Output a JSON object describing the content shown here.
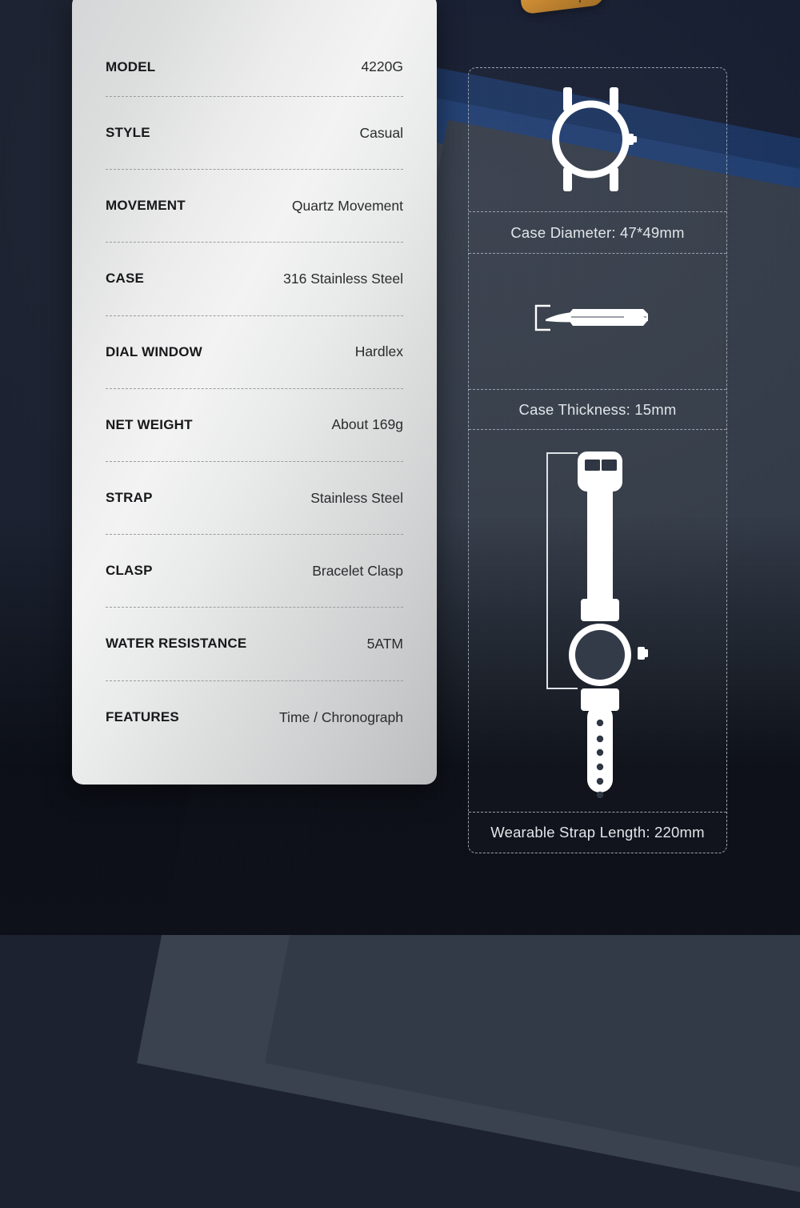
{
  "background": {
    "base_color": "#1b2130",
    "band_navy": "#141b2e",
    "band_blue": "#17305c",
    "band_steel": "#3b424f",
    "gold_accent": "#c7862c"
  },
  "specs_card": {
    "surface_color": "#ececec",
    "label_color": "#17181a",
    "value_color": "#2a2b2d",
    "rows": [
      {
        "label": "MODEL",
        "value": "4220G"
      },
      {
        "label": "STYLE",
        "value": "Casual"
      },
      {
        "label": "MOVEMENT",
        "value": "Quartz Movement"
      },
      {
        "label": "CASE",
        "value": "316 Stainless Steel"
      },
      {
        "label": "DIAL WINDOW",
        "value": "Hardlex"
      },
      {
        "label": "NET WEIGHT",
        "value": "About 169g"
      },
      {
        "label": "STRAP",
        "value": "Stainless Steel"
      },
      {
        "label": "CLASP",
        "value": "Bracelet Clasp"
      },
      {
        "label": "WATER RESISTANCE",
        "value": "5ATM"
      },
      {
        "label": "FEATURES",
        "value": "Time / Chronograph"
      }
    ]
  },
  "dimensions_panel": {
    "text_color": "#e2e6ea",
    "icon_color": "#ffffff",
    "blocks": [
      {
        "icon": "watch-case-front-icon",
        "caption": "Case Diameter: 47*49mm"
      },
      {
        "icon": "watch-case-side-icon",
        "caption": "Case Thickness: 15mm"
      },
      {
        "icon": "watch-strap-full-icon",
        "caption": "Wearable Strap Length: 220mm"
      }
    ]
  }
}
